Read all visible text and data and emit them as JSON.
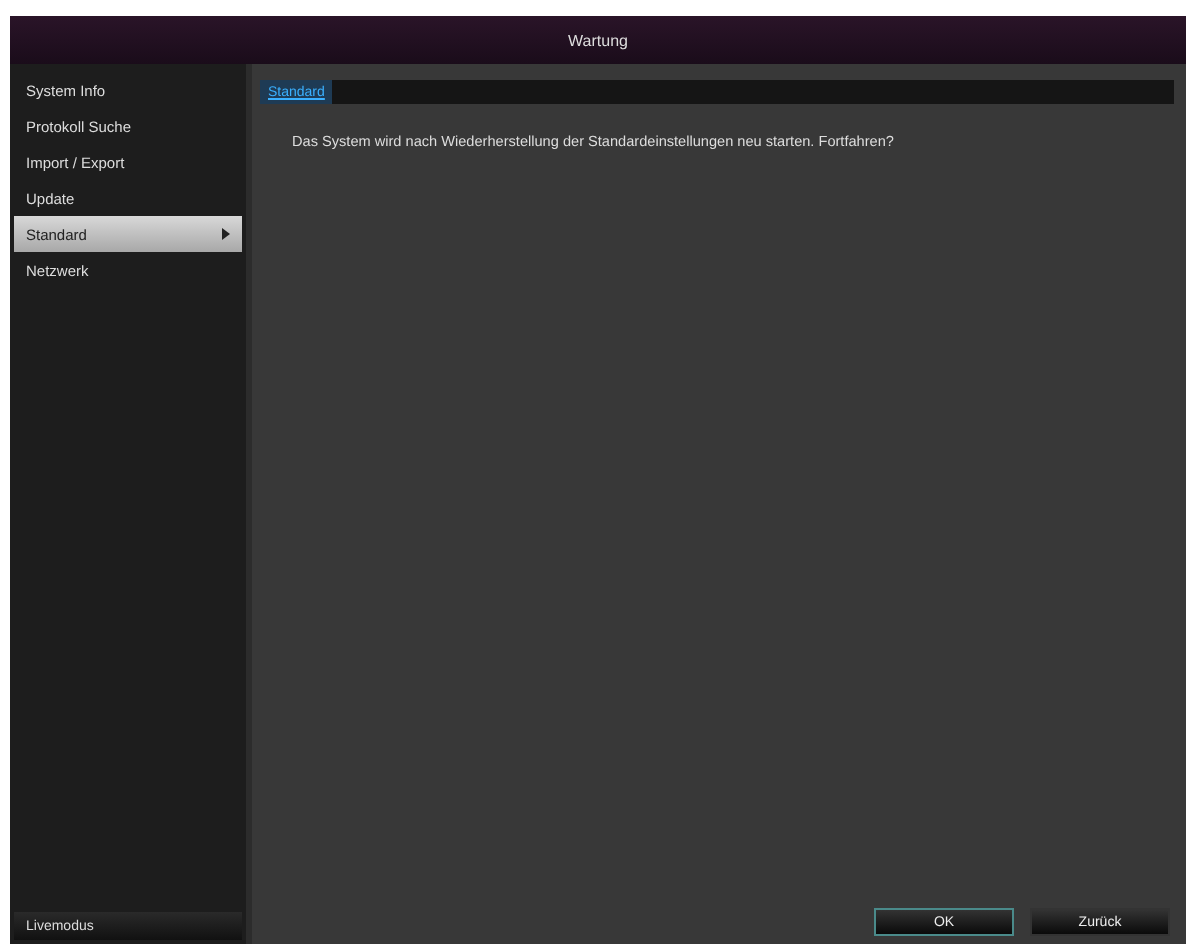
{
  "window": {
    "title": "Wartung"
  },
  "sidebar": {
    "items": [
      {
        "label": "System Info",
        "selected": false
      },
      {
        "label": "Protokoll Suche",
        "selected": false
      },
      {
        "label": "Import / Export",
        "selected": false
      },
      {
        "label": "Update",
        "selected": false
      },
      {
        "label": "Standard",
        "selected": true
      },
      {
        "label": "Netzwerk",
        "selected": false
      }
    ],
    "footer": "Livemodus"
  },
  "tabs": [
    {
      "label": "Standard",
      "selected": true
    }
  ],
  "message": "Das System wird nach Wiederherstellung der Standardeinstellungen neu starten. Fortfahren?",
  "buttons": [
    {
      "label": "OK",
      "kind": "primary"
    },
    {
      "label": "Zurück",
      "kind": "secondary"
    }
  ]
}
